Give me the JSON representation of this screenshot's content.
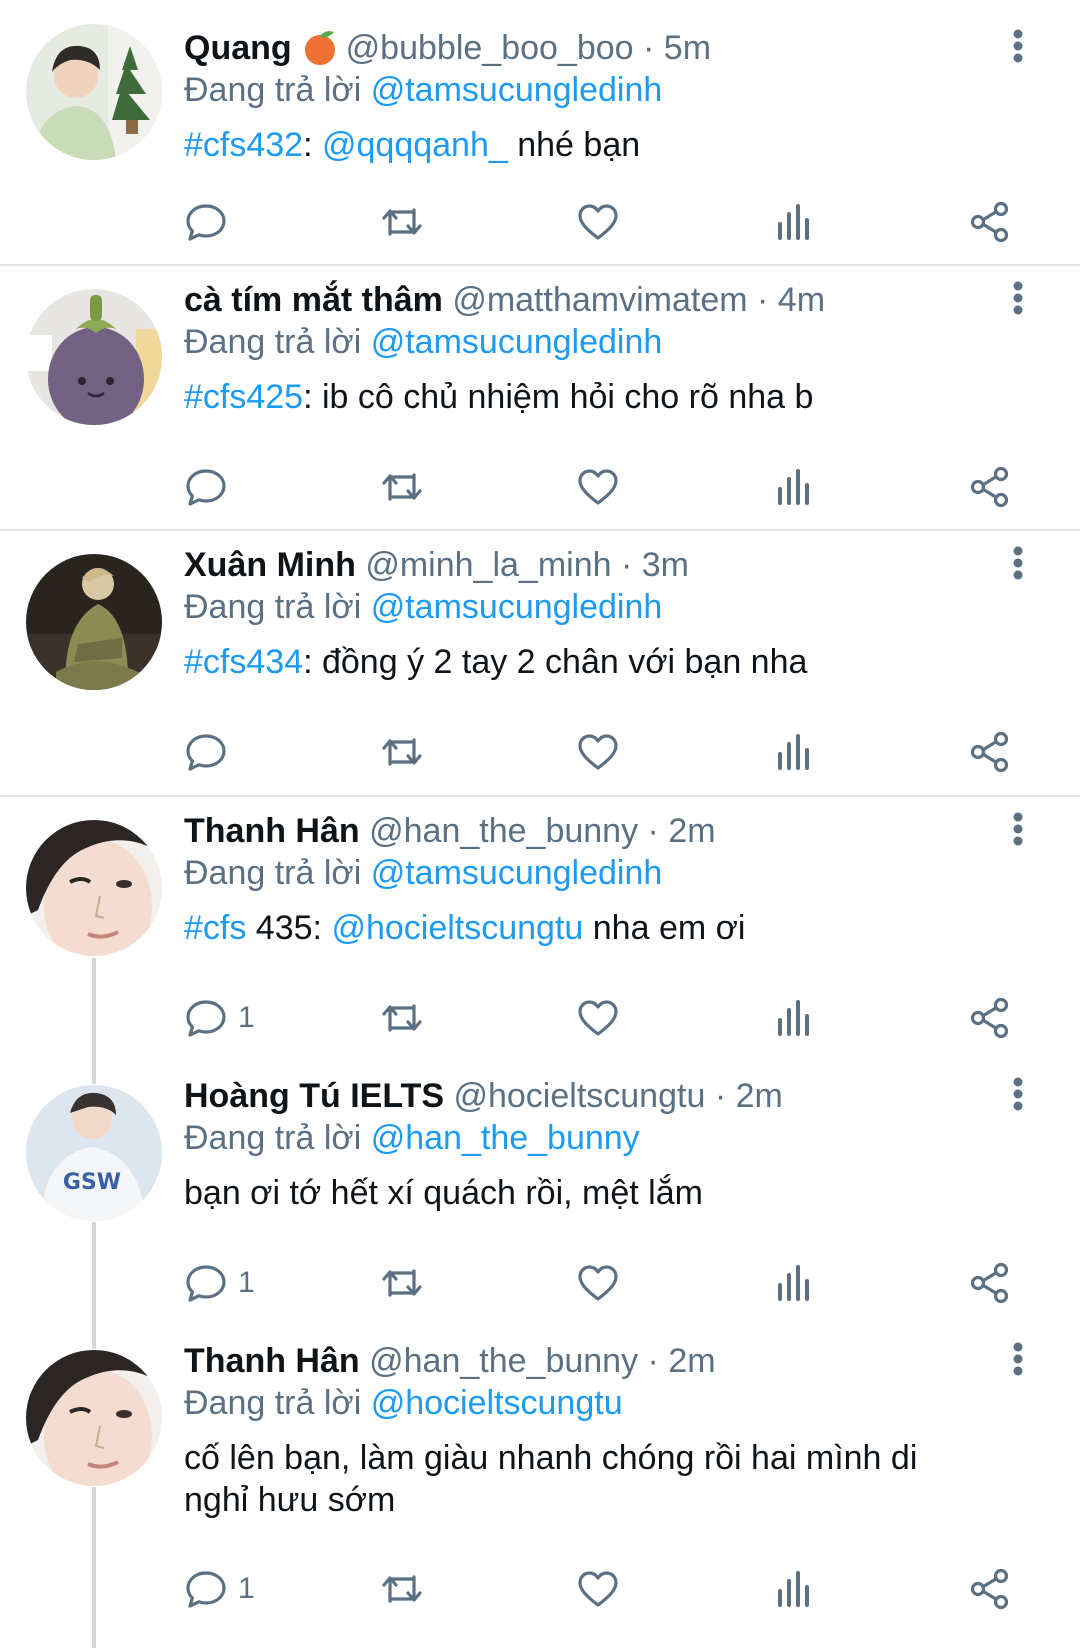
{
  "colors": {
    "link": "#1d9bf0",
    "muted": "#5b7083",
    "text": "#0f1419",
    "divider": "#e1e5e8",
    "thread_line": "#cfd9de"
  },
  "replying_prefix": "Đang trả lời",
  "tweets": [
    {
      "name": "Quang",
      "name_emoji": "peach-emoji",
      "handle": "@bubble_boo_boo",
      "time": "· 5m",
      "replying_to": "@tamsucungledinh",
      "body": [
        {
          "text": "#cfs432",
          "link": true
        },
        {
          "text": ": ",
          "link": false
        },
        {
          "text": "@qqqqanh_",
          "link": true
        },
        {
          "text": " nhé bạn",
          "link": false
        }
      ],
      "reply_count": ""
    },
    {
      "name": "cà tím mắt thâm",
      "handle": "@matthamvimatem",
      "time": "· 4m",
      "replying_to": "@tamsucungledinh",
      "body": [
        {
          "text": "#cfs425",
          "link": true
        },
        {
          "text": ": ib cô chủ nhiệm hỏi cho rõ nha b",
          "link": false
        }
      ],
      "reply_count": ""
    },
    {
      "name": "Xuân Minh",
      "handle": "@minh_la_minh",
      "time": "· 3m",
      "replying_to": "@tamsucungledinh",
      "body": [
        {
          "text": "#cfs434",
          "link": true
        },
        {
          "text": ": đồng ý 2 tay 2 chân với bạn nha",
          "link": false
        }
      ],
      "reply_count": ""
    },
    {
      "name": "Thanh Hân",
      "handle": "@han_the_bunny",
      "time": "· 2m",
      "replying_to": "@tamsucungledinh",
      "body": [
        {
          "text": "#cfs",
          "link": true
        },
        {
          "text": " 435: ",
          "link": false
        },
        {
          "text": "@hocieltscungtu",
          "link": true
        },
        {
          "text": " nha em ơi",
          "link": false
        }
      ],
      "reply_count": "1"
    },
    {
      "name": "Hoàng Tú IELTS",
      "handle": "@hocieltscungtu",
      "time": "· 2m",
      "replying_to": "@han_the_bunny",
      "body": [
        {
          "text": "bạn ơi tớ hết xí quách rồi, mệt lắm",
          "link": false
        }
      ],
      "reply_count": "1"
    },
    {
      "name": "Thanh Hân",
      "handle": "@han_the_bunny",
      "time": "· 2m",
      "replying_to": "@hocieltscungtu",
      "body": [
        {
          "text": "cố lên bạn, làm giàu nhanh chóng rồi hai mình di nghỉ hưu sớm",
          "link": false
        }
      ],
      "reply_count": "1"
    }
  ]
}
